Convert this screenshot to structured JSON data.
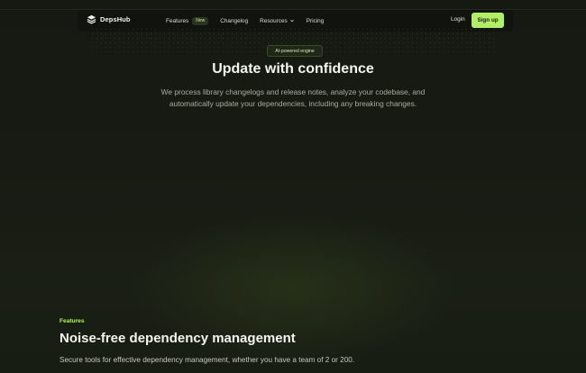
{
  "brand": {
    "name": "DepsHub",
    "accent": "#b3ef65"
  },
  "nav": {
    "items": [
      {
        "label": "Features",
        "badge": "New"
      },
      {
        "label": "Changelog"
      },
      {
        "label": "Resources",
        "icon": "chevron-down-icon"
      },
      {
        "label": "Pricing"
      }
    ],
    "login_label": "Login",
    "signup_label": "Sign up"
  },
  "hero": {
    "pill": "AI-powered engine",
    "title": "Update with confidence",
    "subtitle": "We process library changelogs and release notes, analyze your codebase, and automatically update your dependencies, including any breaking changes."
  },
  "features": {
    "label": "Features",
    "title": "Noise-free dependency management",
    "subtitle": "Secure tools for effective dependency management, whether you have a team of 2 or 200."
  }
}
